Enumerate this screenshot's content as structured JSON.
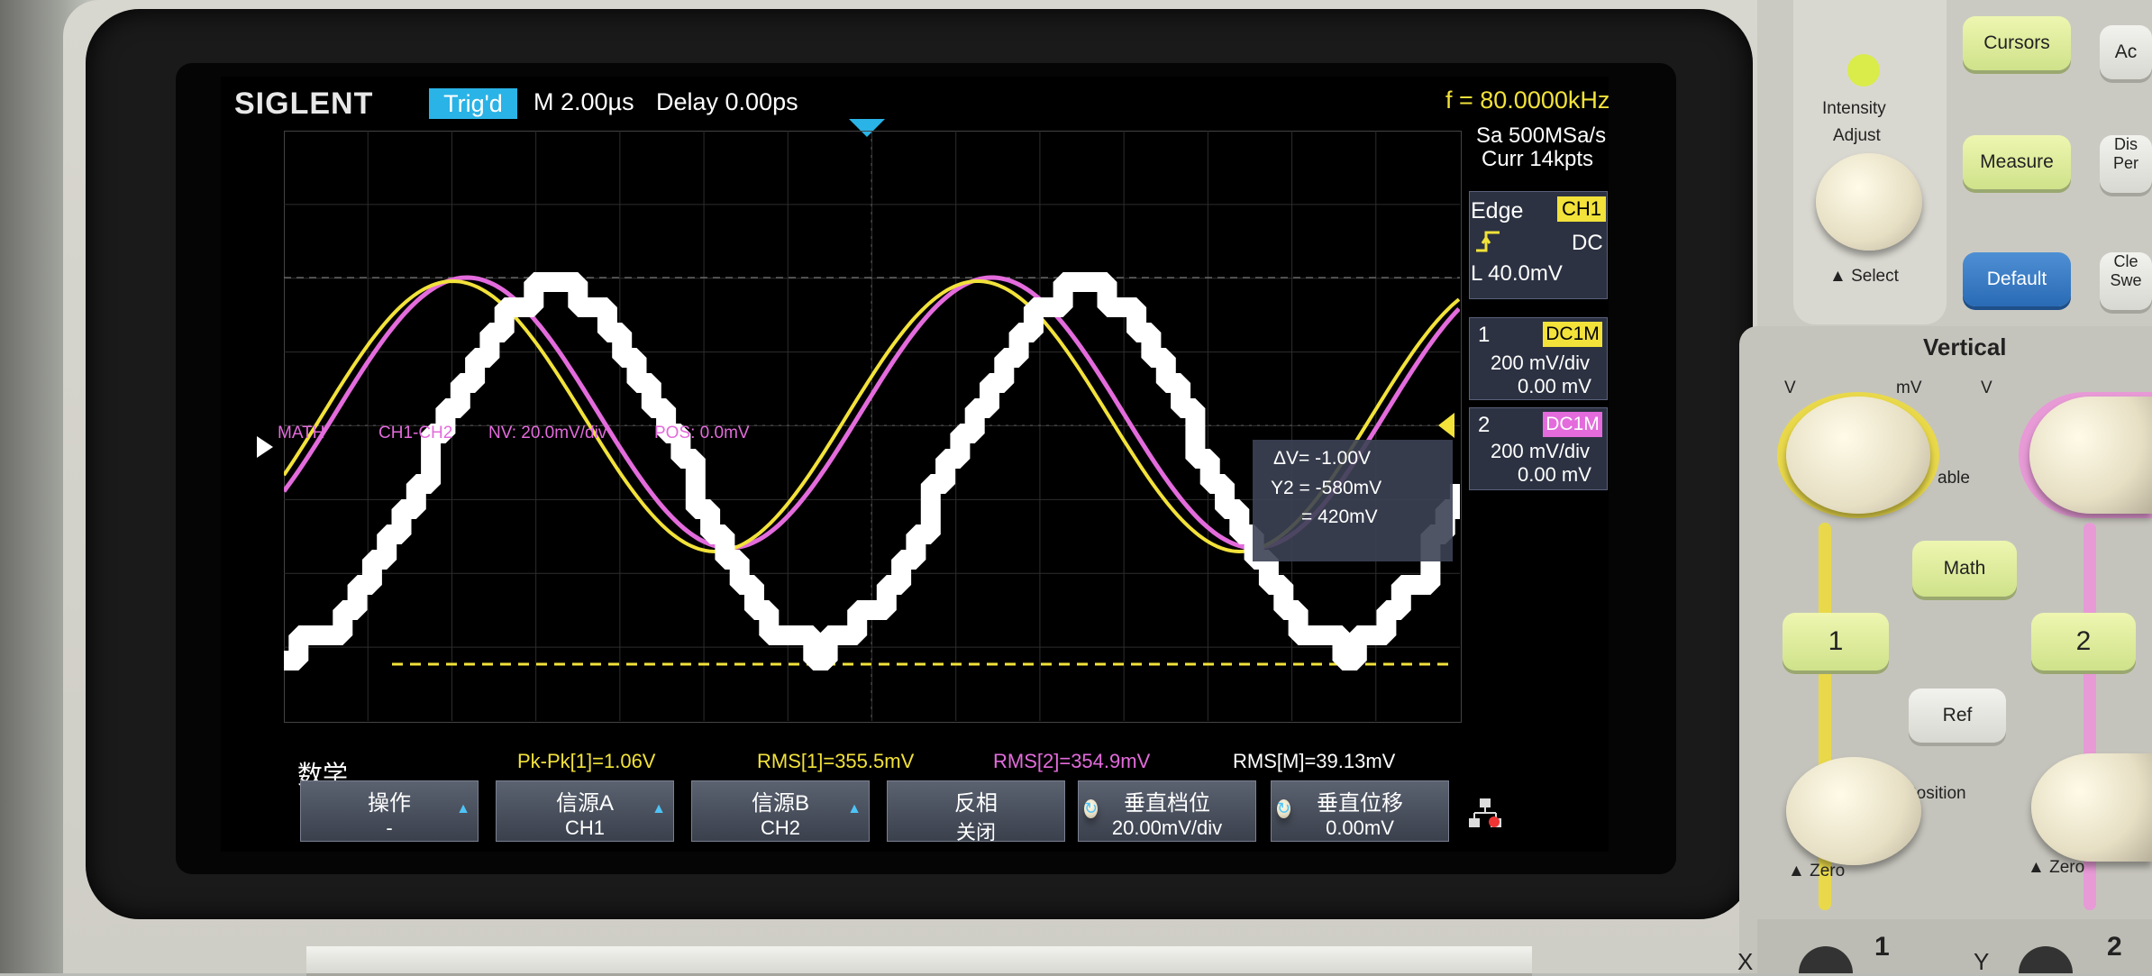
{
  "header": {
    "brand": "SIGLENT",
    "trig_status": "Trig'd",
    "timebase": "M 2.00µs",
    "delay": "Delay 0.00ps",
    "frequency": "f = 80.0000kHz",
    "sample_rate": "Sa 500MSa/s",
    "memory": "Curr 14kpts"
  },
  "trigger": {
    "type": "Edge",
    "source": "CH1",
    "slope_icon": "rising-edge-icon",
    "coupling": "DC",
    "level": "L  40.0mV"
  },
  "channels": [
    {
      "num": "1",
      "coupling": "DC1M",
      "scale": "200 mV/div",
      "offset": "0.00 mV",
      "color": "#f2e23a"
    },
    {
      "num": "2",
      "coupling": "DC1M",
      "scale": "200 mV/div",
      "offset": "0.00 mV",
      "color": "#e36bdc"
    }
  ],
  "math_info": {
    "label": "MATH",
    "expr": "CH1-CH2",
    "scale": "NV: 20.0mV/div",
    "pos": "POS: 0.0mV"
  },
  "cursor": {
    "dv": "ΔV= -1.00V",
    "y2": "Y2 = -580mV",
    "y1": "= 420mV"
  },
  "menu": {
    "title": "数学"
  },
  "measurements": {
    "pkpk": "Pk-Pk[1]=1.06V",
    "rms1": "RMS[1]=355.5mV",
    "rms2": "RMS[2]=354.9mV",
    "rmsm": "RMS[M]=39.13mV"
  },
  "softkeys": [
    {
      "title": "操作",
      "value": "-"
    },
    {
      "title": "信源A",
      "value": "CH1"
    },
    {
      "title": "信源B",
      "value": "CH2"
    },
    {
      "title": "反相",
      "value": "关闭"
    },
    {
      "title": "垂直档位",
      "value": "20.00mV/div"
    },
    {
      "title": "垂直位移",
      "value": "0.00mV"
    }
  ],
  "front_panel": {
    "intensity": "Intensity",
    "adjust": "Adjust",
    "select": "Select",
    "cursors": "Cursors",
    "measure": "Measure",
    "default": "Default",
    "partial_ac": "Ac",
    "partial_dis": "Dis",
    "partial_per": "Per",
    "partial_cle": "Cle",
    "partial_swe": "Swe",
    "vertical": "Vertical",
    "v_label": "V",
    "mv_label": "mV",
    "able": "able",
    "math": "Math",
    "ch1": "1",
    "ch2": "2",
    "ref": "Ref",
    "position": "Position",
    "zero": "Zero",
    "x_label": "X",
    "y_label": "Y"
  },
  "colors": {
    "ch1": "#f2e23a",
    "ch2": "#e36bdc",
    "math": "#ffffff",
    "accent": "#2ab3e6"
  }
}
